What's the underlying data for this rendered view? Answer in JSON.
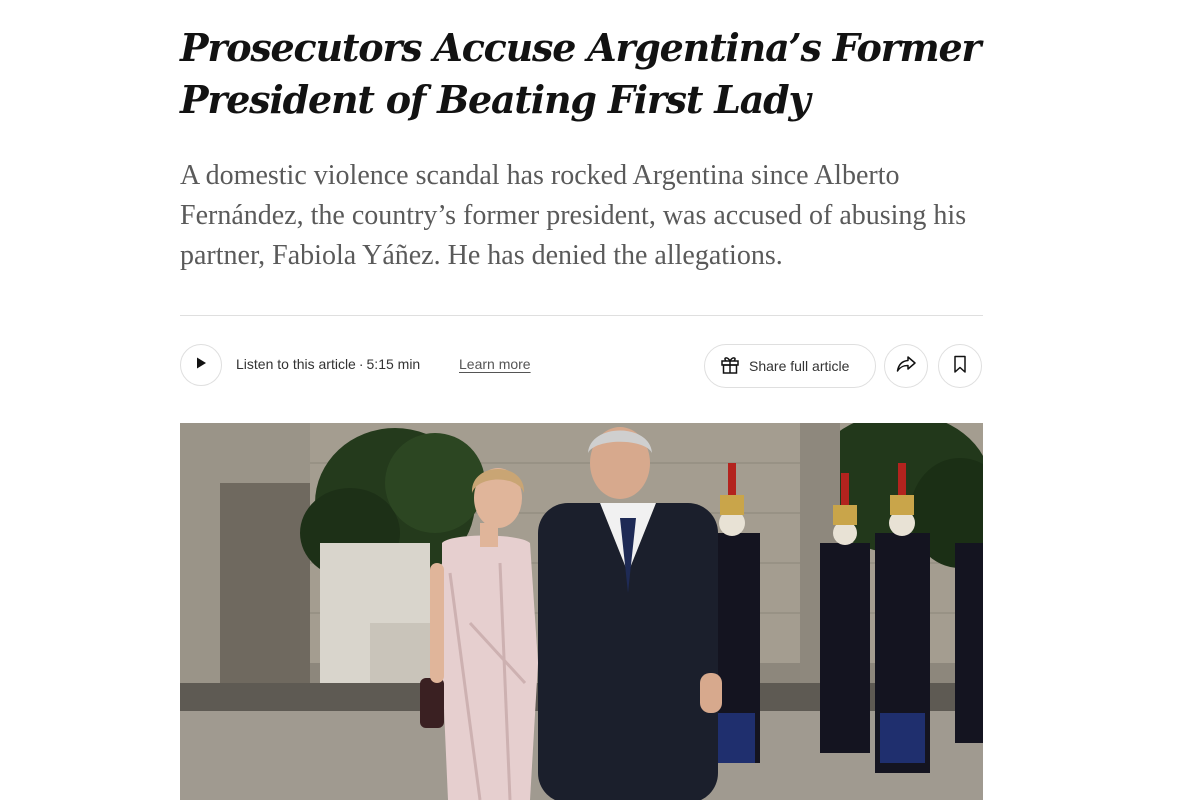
{
  "article": {
    "headline": "Prosecutors Accuse Argentina’s Former President of Beating First Lady",
    "summary": "A domestic violence scandal has rocked Argentina since Alberto Fernández, the country’s former president, was accused of abusing his partner, Fabiola Yáñez. He has denied the allegations."
  },
  "toolbar": {
    "listen_label": "Listen to this article",
    "separator": "·",
    "duration": "5:15 min",
    "learn_more": "Learn more",
    "share_full_article": "Share full article",
    "icons": {
      "play": "play-icon",
      "gift": "gift-icon",
      "share": "share-arrow-icon",
      "save": "bookmark-icon"
    }
  },
  "colors": {
    "headline": "#121212",
    "summary": "#5a5a5a",
    "border": "#dfdfdf"
  }
}
